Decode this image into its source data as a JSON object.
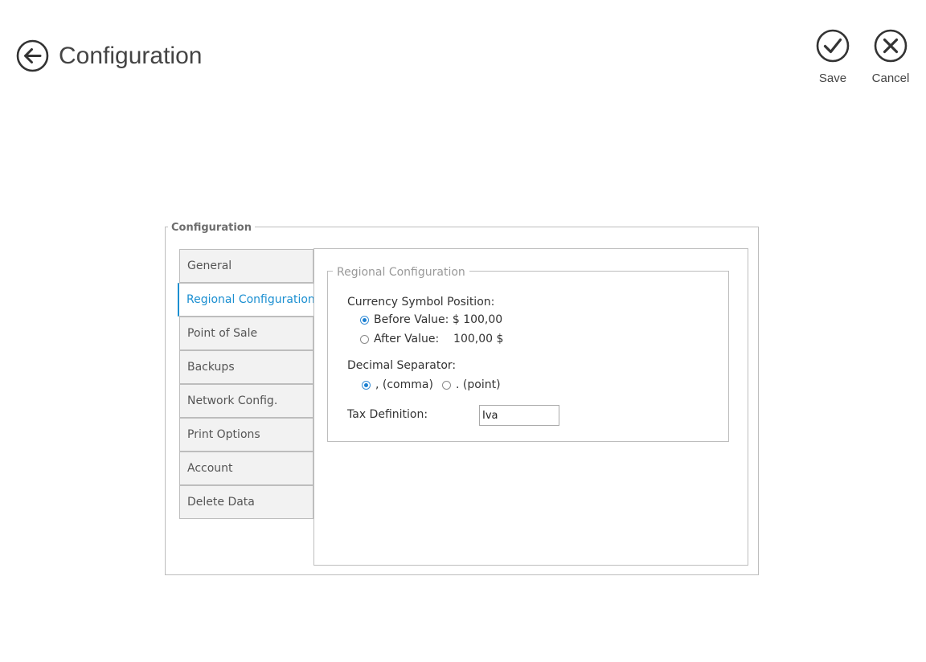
{
  "header": {
    "title": "Configuration",
    "save_label": "Save",
    "cancel_label": "Cancel"
  },
  "config_group": {
    "legend": "Configuration",
    "tabs": [
      {
        "label": "General",
        "active": false
      },
      {
        "label": "Regional Configuration",
        "active": true
      },
      {
        "label": "Point of Sale",
        "active": false
      },
      {
        "label": "Backups",
        "active": false
      },
      {
        "label": "Network Config.",
        "active": false
      },
      {
        "label": "Print Options",
        "active": false
      },
      {
        "label": "Account",
        "active": false
      },
      {
        "label": "Delete Data",
        "active": false
      }
    ]
  },
  "regional": {
    "legend": "Regional Configuration",
    "currency_position_label": "Currency Symbol Position:",
    "currency_options": [
      {
        "label": "Before Value: $ 100,00",
        "checked": true
      },
      {
        "label": "After Value:    100,00 $",
        "checked": false
      }
    ],
    "decimal_separator_label": "Decimal Separator:",
    "decimal_options": [
      {
        "label": ", (comma)",
        "checked": true
      },
      {
        "label": ". (point)",
        "checked": false
      }
    ],
    "tax_definition_label": "Tax Definition:",
    "tax_definition_value": "Iva"
  },
  "colors": {
    "accent": "#1b8fd1",
    "border": "#bdbdbd",
    "tab_bg": "#f2f2f2"
  }
}
